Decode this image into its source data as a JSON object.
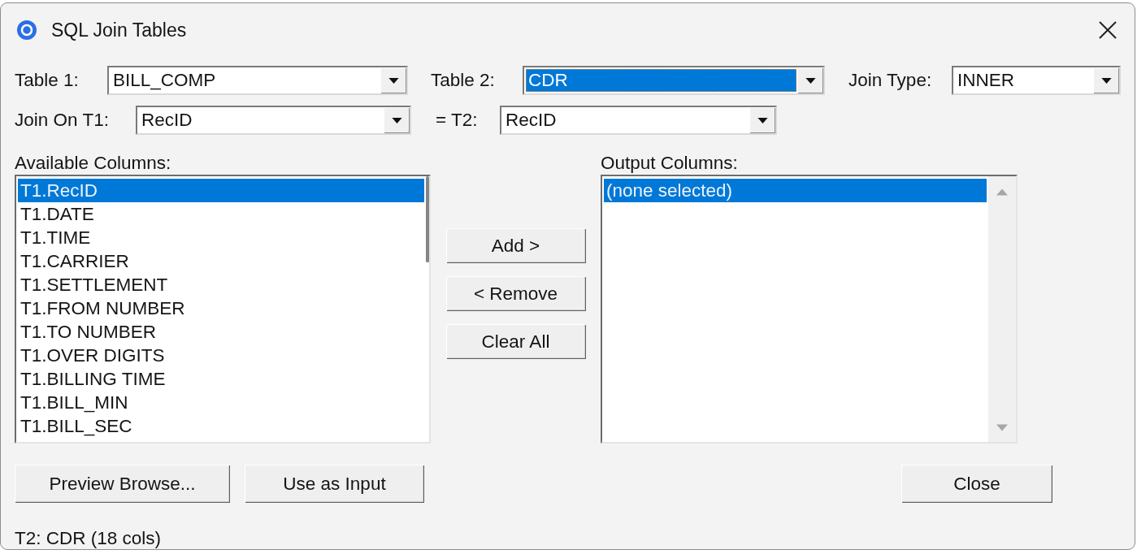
{
  "window": {
    "title": "SQL Join Tables"
  },
  "table_row": [
    {
      "label": "Table 1:",
      "value": "BILL_COMP",
      "focused": false
    },
    {
      "label": "Table 2:",
      "value": "CDR",
      "focused": true
    },
    {
      "label": "Join Type:",
      "value": "INNER",
      "focused": false
    }
  ],
  "join_row": [
    {
      "label": "Join On T1:",
      "value": "RecID",
      "focused": false
    },
    {
      "label": "= T2:",
      "value": "RecID",
      "focused": false
    }
  ],
  "available_columns": {
    "label": "Available Columns:",
    "items": [
      {
        "text": "T1.RecID",
        "selected": true
      },
      {
        "text": "T1.DATE",
        "selected": false
      },
      {
        "text": "T1.TIME",
        "selected": false
      },
      {
        "text": "T1.CARRIER",
        "selected": false
      },
      {
        "text": "T1.SETTLEMENT",
        "selected": false
      },
      {
        "text": "T1.FROM NUMBER",
        "selected": false
      },
      {
        "text": "T1.TO NUMBER",
        "selected": false
      },
      {
        "text": "T1.OVER DIGITS",
        "selected": false
      },
      {
        "text": "T1.BILLING TIME",
        "selected": false
      },
      {
        "text": "T1.BILL_MIN",
        "selected": false
      },
      {
        "text": "T1.BILL_SEC",
        "selected": false
      }
    ]
  },
  "move_buttons": [
    "Add >",
    "< Remove",
    "Clear All"
  ],
  "output_columns": {
    "label": "Output Columns:",
    "items": [
      {
        "text": "(none selected)",
        "selected": true
      }
    ]
  },
  "bottom_buttons": [
    "Preview Browse...",
    "Use as Input",
    "Close"
  ],
  "status_bar": "T2: CDR (18 cols)"
}
